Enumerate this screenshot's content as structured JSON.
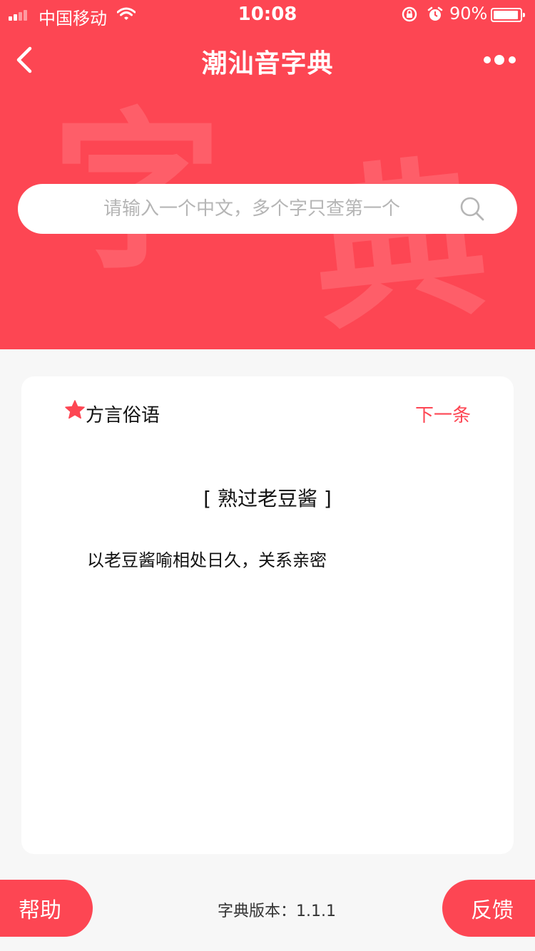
{
  "status_bar": {
    "carrier": "中国移动",
    "time": "10:08",
    "battery": "90%"
  },
  "nav": {
    "title": "潮汕音字典",
    "back_icon": "chevron-left-icon",
    "more_icon": "more-dots-icon"
  },
  "hero": {
    "watermark_left": "字",
    "watermark_right": "典"
  },
  "search": {
    "value": "",
    "placeholder": "请输入一个中文，多个字只查第一个",
    "icon": "search-icon"
  },
  "card": {
    "title": "方言俗语",
    "next_label": "下一条",
    "phrase": "[ 熟过老豆酱 ]",
    "meaning": "以老豆酱喻相处日久，关系亲密"
  },
  "footer": {
    "help_label": "帮助",
    "version": "字典版本：1.1.1",
    "feedback_label": "反馈"
  },
  "colors": {
    "accent": "#fd4653",
    "watermark": "#fe5e69",
    "background": "#f7f7f7"
  }
}
